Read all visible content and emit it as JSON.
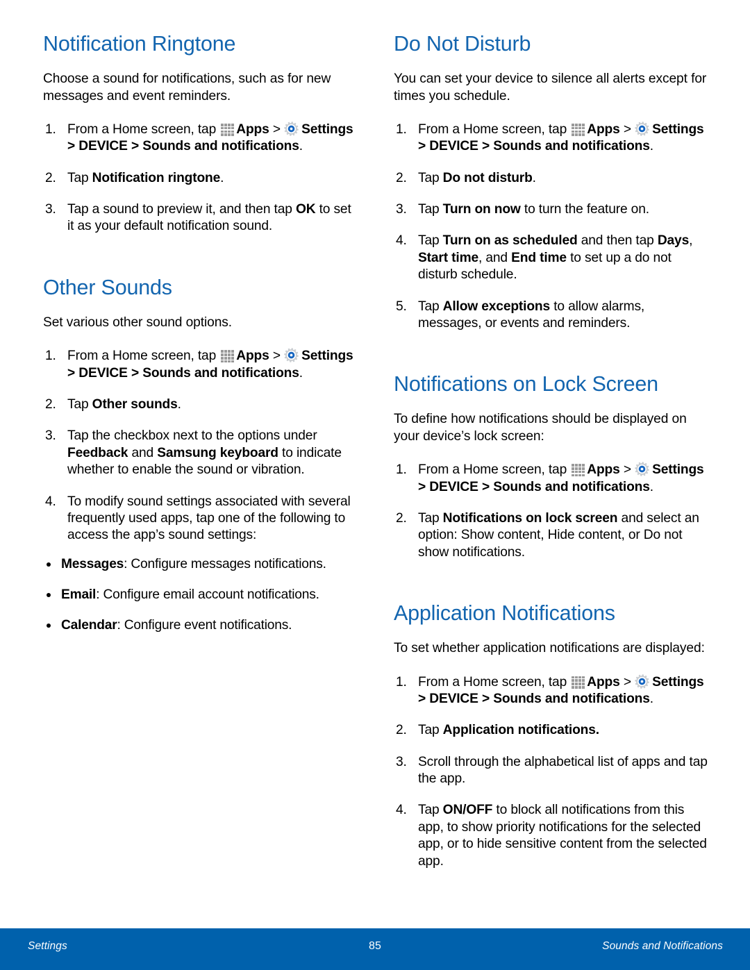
{
  "icons": {
    "apps": "apps-grid-icon",
    "settings": "settings-gear-icon"
  },
  "colors": {
    "heading_blue": "#1365AF",
    "footer_blue": "#0061AC",
    "body_text": "#000000"
  },
  "columns": {
    "left": {
      "sections": [
        {
          "heading": "Notification Ringtone",
          "intro": "Choose a sound for notifications, such as for new messages and event reminders.",
          "steps": [
            {
              "num": "1.",
              "kind": "apps-settings",
              "pre": "From a Home screen, tap ",
              "apps_label": "Apps",
              "sep1": " > ",
              "settings_path": "Settings > DEVICE > Sounds and notifications",
              "post": "."
            },
            {
              "num": "2.",
              "kind": "text",
              "html": "Tap <b>Notification ringtone</b>."
            },
            {
              "num": "3.",
              "kind": "text",
              "html": "Tap a sound to preview it, and then tap <b>OK</b> to set it as your default notification sound."
            }
          ]
        },
        {
          "heading": "Other Sounds",
          "intro": "Set various other sound options.",
          "steps": [
            {
              "num": "1.",
              "kind": "apps-settings",
              "pre": "From a Home screen, tap ",
              "apps_label": "Apps",
              "sep1": " > ",
              "settings_path": "Settings > DEVICE > Sounds and notifications",
              "post": "."
            },
            {
              "num": "2.",
              "kind": "text",
              "html": "Tap <b>Other sounds</b>."
            },
            {
              "num": "3.",
              "kind": "text",
              "html": "Tap the checkbox next to the options under <b>Feedback</b> and <b>Samsung keyboard</b> to indicate whether to enable the sound or vibration."
            },
            {
              "num": "4.",
              "kind": "text",
              "html": "To modify sound settings associated with several frequently used apps, tap one of the following to access the app’s sound settings:"
            }
          ],
          "bullets": [
            "<b>Messages</b>: Configure messages notifications.",
            "<b>Email</b>: Configure email account notifications.",
            "<b>Calendar</b>: Configure event notifications."
          ]
        }
      ]
    },
    "right": {
      "sections": [
        {
          "heading": "Do Not Disturb",
          "intro": "You can set your device to silence all alerts except for times you schedule.",
          "steps": [
            {
              "num": "1.",
              "kind": "apps-settings",
              "pre": "From a Home screen, tap ",
              "apps_label": "Apps",
              "sep1": " > ",
              "settings_path": "Settings > DEVICE > Sounds and notifications",
              "post": "."
            },
            {
              "num": "2.",
              "kind": "text",
              "html": "Tap <b>Do not disturb</b>."
            },
            {
              "num": "3.",
              "kind": "text",
              "html": "Tap <b>Turn on now</b> to turn the feature on."
            },
            {
              "num": "4.",
              "kind": "text",
              "html": "Tap <b>Turn on as scheduled</b> and then tap <b>Days</b>, <b>Start time</b>, and <b>End time</b> to set up a do not disturb schedule."
            },
            {
              "num": "5.",
              "kind": "text",
              "html": "Tap <b>Allow exceptions</b> to allow alarms, messages, or events and reminders."
            }
          ]
        },
        {
          "heading": "Notifications on Lock Screen",
          "intro": "To define how notifications should be displayed on your device’s lock screen:",
          "steps": [
            {
              "num": "1.",
              "kind": "apps-settings",
              "pre": "From a Home screen, tap ",
              "apps_label": "Apps",
              "sep1": " > ",
              "settings_path": "Settings > DEVICE > Sounds and notifications",
              "post": "."
            },
            {
              "num": "2.",
              "kind": "text",
              "html": "Tap <b>Notifications on lock screen</b> and select an option: Show content, Hide content, or Do not show notifications."
            }
          ]
        },
        {
          "heading": "Application Notifications",
          "intro": "To set whether application notifications are displayed:",
          "steps": [
            {
              "num": "1.",
              "kind": "apps-settings",
              "pre": "From a Home screen, tap ",
              "apps_label": "Apps",
              "sep1": " > ",
              "settings_path": "Settings > DEVICE > Sounds and notifications",
              "post": "."
            },
            {
              "num": "2.",
              "kind": "text",
              "html": "Tap <b>Application notifications.</b>"
            },
            {
              "num": "3.",
              "kind": "text",
              "html": "Scroll through the alphabetical list of apps and tap the app."
            },
            {
              "num": "4.",
              "kind": "text",
              "html": "Tap <b>ON/OFF</b> to block all notifications from this app, to show priority notifications for the selected app, or to hide sensitive content from the selected app."
            }
          ]
        }
      ]
    }
  },
  "footer": {
    "left": "Settings",
    "page_number": "85",
    "right": "Sounds and Notifications"
  }
}
